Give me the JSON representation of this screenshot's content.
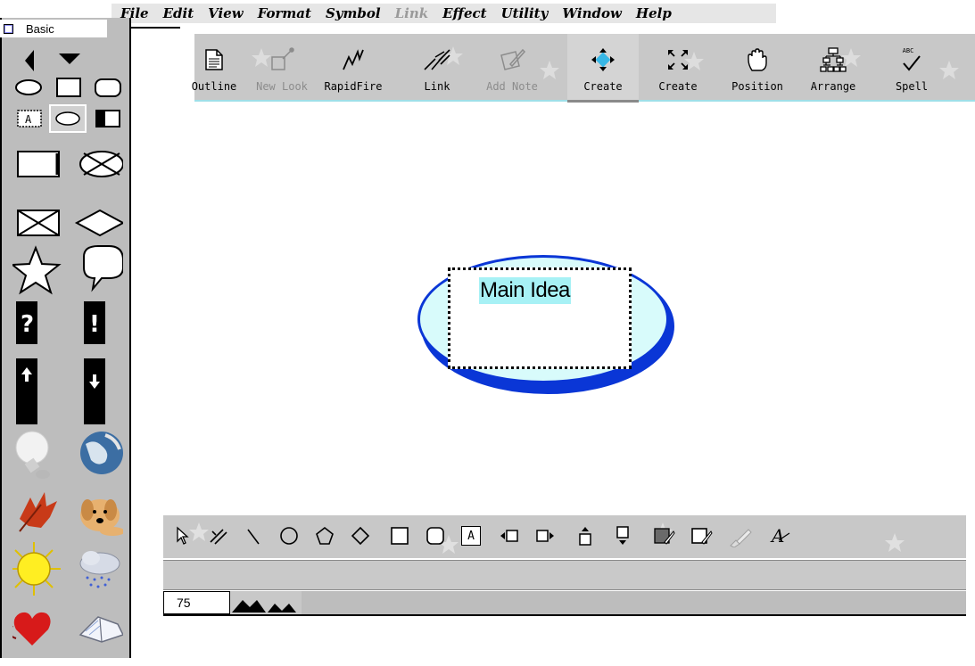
{
  "menubar": {
    "items": [
      {
        "label": "File",
        "enabled": true
      },
      {
        "label": "Edit",
        "enabled": true
      },
      {
        "label": "View",
        "enabled": true
      },
      {
        "label": "Format",
        "enabled": true
      },
      {
        "label": "Symbol",
        "enabled": true
      },
      {
        "label": "Link",
        "enabled": false
      },
      {
        "label": "Effect",
        "enabled": true
      },
      {
        "label": "Utility",
        "enabled": true
      },
      {
        "label": "Window",
        "enabled": true
      },
      {
        "label": "Help",
        "enabled": true
      }
    ]
  },
  "palette": {
    "title": "Basic",
    "icons": [
      "left-arrow-icon",
      "down-arrow-icon",
      "oval-icon",
      "rectangle-icon",
      "rounded-rectangle-icon",
      "text-box-icon",
      "oval-outline-icon",
      "half-filled-rectangle-icon",
      "process-box-icon",
      "crossed-oval-icon",
      "crossed-box-icon",
      "diamond-icon",
      "star-icon",
      "speech-bubble-icon",
      "question-mark-icon",
      "exclamation-mark-icon",
      "up-arrow-box-icon",
      "down-arrow-box-icon",
      "light-bulb-icon",
      "earth-globe-icon",
      "autumn-leaf-icon",
      "dog-icon",
      "sun-icon",
      "rain-cloud-icon",
      "heart-icon",
      "open-book-icon"
    ]
  },
  "toolbar": {
    "buttons": [
      {
        "label": "Outline",
        "icon": "document-icon",
        "enabled": true
      },
      {
        "label": "New Look",
        "icon": "paint-brush-icon",
        "enabled": false
      },
      {
        "label": "RapidFire",
        "icon": "lightning-icon",
        "enabled": true
      },
      {
        "label": "Link",
        "icon": "link-icon",
        "enabled": true
      },
      {
        "label": "Add Note",
        "icon": "note-pencil-icon",
        "enabled": false
      },
      {
        "label": "Create",
        "icon": "create-arrows-icon",
        "enabled": true
      },
      {
        "label": "Create",
        "icon": "expand-icon",
        "enabled": true
      },
      {
        "label": "Position",
        "icon": "hand-icon",
        "enabled": true
      },
      {
        "label": "Arrange",
        "icon": "hierarchy-icon",
        "enabled": true
      },
      {
        "label": "Spell",
        "icon": "spell-check-icon",
        "enabled": true
      }
    ],
    "spell_badge": "ABC"
  },
  "canvas": {
    "main_symbol_text": "Main Idea",
    "colors": {
      "fill": "#d8fbfb",
      "outline": "#0a36d6",
      "highlight": "#a7f1f5"
    }
  },
  "drawbar": {
    "tools": [
      "pointer-icon",
      "pen-transform-icon",
      "line-icon",
      "circle-icon",
      "pentagon-icon",
      "diamond-outline-icon",
      "square-icon",
      "rounded-square-icon",
      "text-icon",
      "nudge-left-icon",
      "nudge-right-icon",
      "bring-forward-icon",
      "send-backward-icon",
      "fill-color-icon",
      "line-color-icon",
      "brush-icon",
      "font-style-icon"
    ],
    "text_label": "A",
    "zoom": "75"
  }
}
